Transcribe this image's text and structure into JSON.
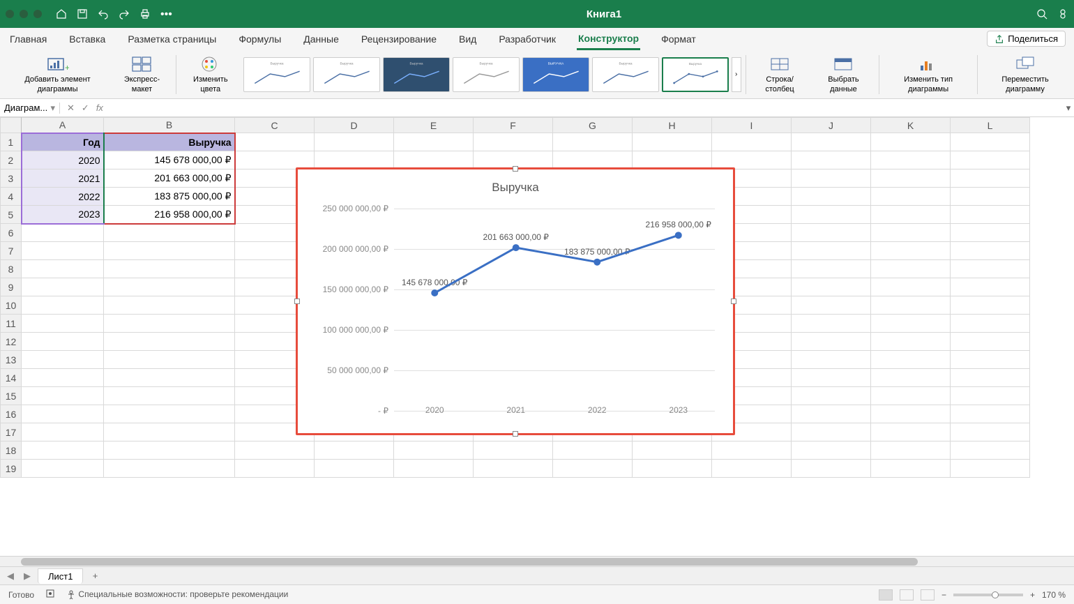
{
  "app": {
    "title": "Книга1"
  },
  "tabs": {
    "items": [
      "Главная",
      "Вставка",
      "Разметка страницы",
      "Формулы",
      "Данные",
      "Рецензирование",
      "Вид",
      "Разработчик",
      "Конструктор",
      "Формат"
    ],
    "active_index": 8,
    "share": "Поделиться"
  },
  "ribbon": {
    "add_element": "Добавить элемент диаграммы",
    "quick_layout": "Экспресс-макет",
    "change_colors": "Изменить цвета",
    "row_column": "Строка/столбец",
    "select_data": "Выбрать данные",
    "change_type": "Изменить тип диаграммы",
    "move_chart": "Переместить диаграмму",
    "style_thumb_label": "Выручка"
  },
  "name_box": "Диаграм...",
  "formula_bar": {
    "fx": "fx",
    "value": ""
  },
  "columns": [
    "A",
    "B",
    "C",
    "D",
    "E",
    "F",
    "G",
    "H",
    "I",
    "J",
    "K",
    "L"
  ],
  "rows_visible": 19,
  "data": {
    "headers": [
      "Год",
      "Выручка"
    ],
    "rows": [
      [
        "2020",
        "145 678 000,00 ₽"
      ],
      [
        "2021",
        "201 663 000,00 ₽"
      ],
      [
        "2022",
        "183 875 000,00 ₽"
      ],
      [
        "2023",
        "216 958 000,00 ₽"
      ]
    ]
  },
  "chart_data": {
    "type": "line",
    "title": "Выручка",
    "categories": [
      "2020",
      "2021",
      "2022",
      "2023"
    ],
    "values": [
      145678000,
      201663000,
      183875000,
      216958000
    ],
    "data_labels": [
      "145 678 000,00 ₽",
      "201 663 000,00 ₽",
      "183 875 000,00 ₽",
      "216 958 000,00 ₽"
    ],
    "y_ticks": [
      0,
      50000000,
      100000000,
      150000000,
      200000000,
      250000000
    ],
    "y_tick_labels": [
      "-   ₽",
      "50 000 000,00  ₽",
      "100 000 000,00  ₽",
      "150 000 000,00  ₽",
      "200 000 000,00  ₽",
      "250 000 000,00  ₽"
    ],
    "ylim": [
      0,
      250000000
    ],
    "series_color": "#3a6fc4"
  },
  "sheet": {
    "name": "Лист1"
  },
  "status": {
    "ready": "Готово",
    "accessibility": "Специальные возможности: проверьте рекомендации",
    "zoom": "170 %"
  }
}
